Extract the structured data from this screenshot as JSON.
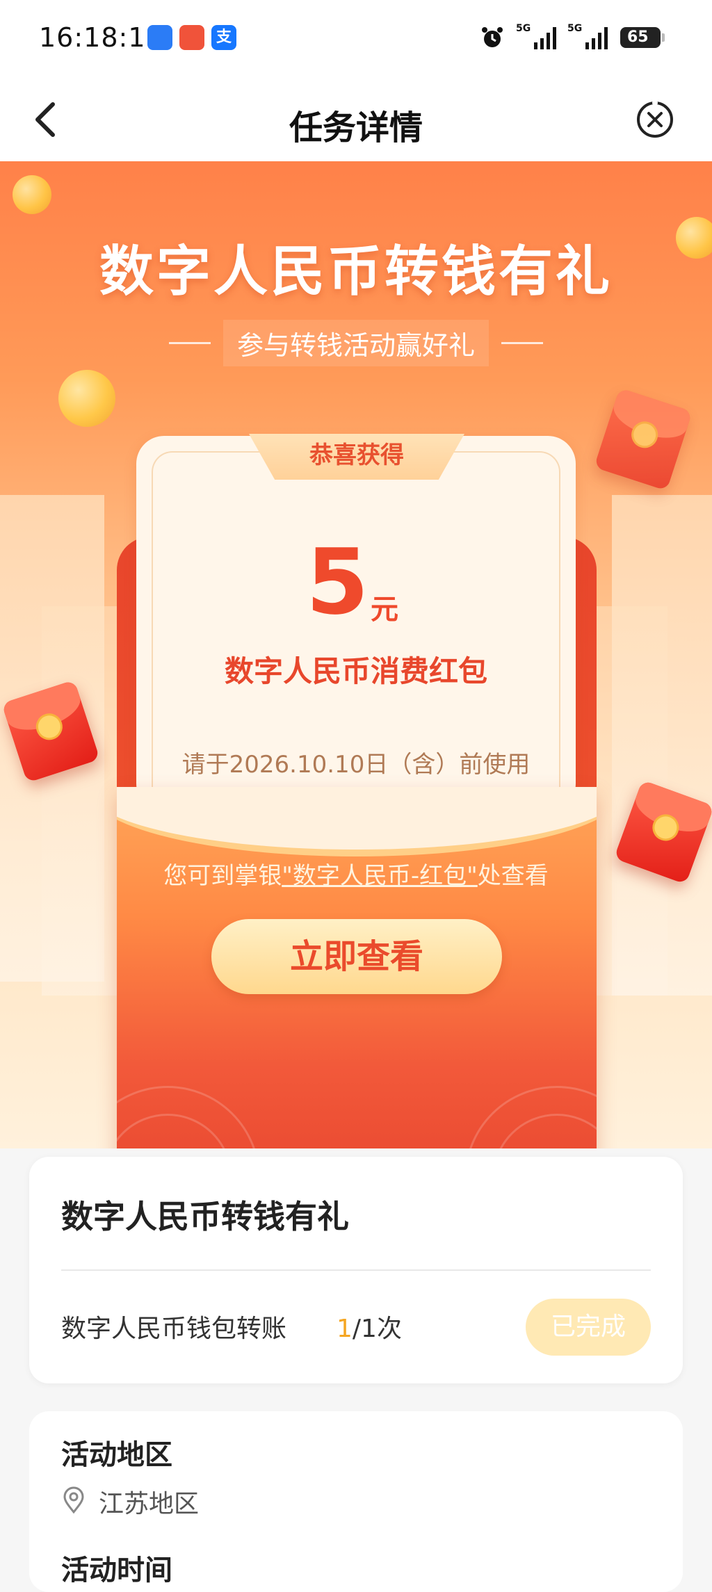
{
  "status_bar": {
    "time": "16:18:11",
    "apps": [
      {
        "name": "baidu-app-icon",
        "glyph": "",
        "color": "#2b7cf6"
      },
      {
        "name": "cartoon-app-icon",
        "glyph": "",
        "color": "#f0533a"
      },
      {
        "name": "alipay-icon",
        "glyph": "支",
        "color": "#1677ff"
      }
    ],
    "signal1_label": "5G",
    "signal2_label": "5G",
    "battery": "65"
  },
  "nav": {
    "title": "任务详情"
  },
  "hero": {
    "title": "数字人民币转钱有礼",
    "subtitle": "参与转钱活动赢好礼"
  },
  "reward_card": {
    "congrats": "恭喜获得",
    "amount": "5",
    "unit": "元",
    "name": "数字人民币消费红包",
    "expire": "请于2026.10.10日（含）前使用",
    "hint_prefix": "您可到掌银",
    "hint_link": "\"数字人民币-红包\"",
    "hint_suffix": "处查看",
    "button": "立即查看"
  },
  "task": {
    "title": "数字人民币转钱有礼",
    "item_name": "数字人民币钱包转账",
    "progress_done": "1",
    "progress_rest": "/1次",
    "status_button": "已完成"
  },
  "region": {
    "title": "活动地区",
    "value": "江苏地区",
    "time_title": "活动时间"
  },
  "colors": {
    "accent": "#ef4a2c",
    "hero_top": "#ff8149",
    "button_gold": "#ffd88e",
    "progress": "#f5a623"
  }
}
